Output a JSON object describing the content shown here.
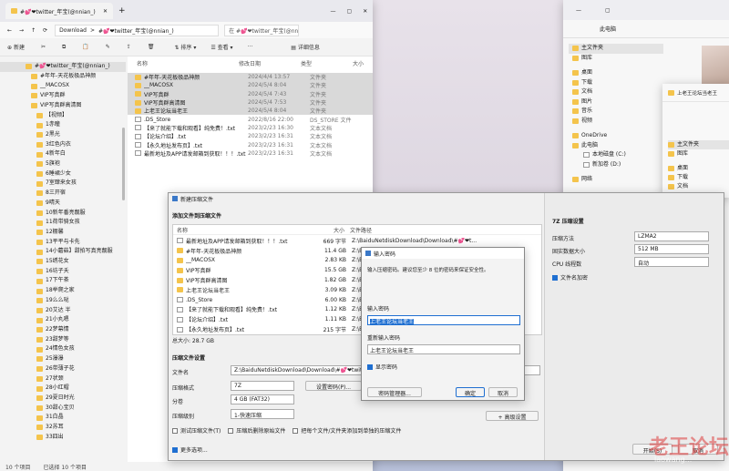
{
  "explorer_main": {
    "tab_title": "#💕❤twitter_年宝(@nnian_)",
    "close_icon": "✕",
    "min_icon": "—",
    "max_icon": "▢",
    "address": [
      "Download",
      ">",
      "#💕❤twitter_年宝(@nnian_)",
      ">"
    ],
    "search_placeholder": "在 #💕❤twitter_年宝(@nnian_)...",
    "toolbar": {
      "new": "新建",
      "sort": "排序",
      "view": "查看",
      "details": "详细信息"
    },
    "columns": {
      "name": "名称",
      "date": "修改日期",
      "type": "类型",
      "size": "大小"
    },
    "files": [
      {
        "name": "#年年-天花板极品神颜",
        "date": "2024/4/4 13:57",
        "type": "文件夹",
        "kind": "folder"
      },
      {
        "name": "__MACOSX",
        "date": "2024/5/4 8:04",
        "type": "文件夹",
        "kind": "folder"
      },
      {
        "name": "VIP写真群",
        "date": "2024/5/4 7:43",
        "type": "文件夹",
        "kind": "folder"
      },
      {
        "name": "VIP写真群高清图",
        "date": "2024/5/4 7:53",
        "type": "文件夹",
        "kind": "folder"
      },
      {
        "name": "上老王论坛当老王",
        "date": "2024/5/4 8:04",
        "type": "文件夹",
        "kind": "folder"
      },
      {
        "name": ".DS_Store",
        "date": "2022/8/16 22:00",
        "type": "DS_STORE 文件",
        "kind": "file"
      },
      {
        "name": "【来了就能下载和观看】纯免费！.txt",
        "date": "2023/2/23 16:30",
        "type": "文本文档",
        "kind": "file"
      },
      {
        "name": "【论坛介绍】.txt",
        "date": "2023/2/23 16:31",
        "type": "文本文档",
        "kind": "file"
      },
      {
        "name": "【永久地址发布页】.txt",
        "date": "2023/2/23 16:31",
        "type": "文本文档",
        "kind": "file"
      },
      {
        "name": "最新地址及APP请发邮箱到获取！！！.txt",
        "date": "2023/2/23 16:31",
        "type": "文本文档",
        "kind": "file"
      }
    ],
    "tree": [
      "#💕❤twitter_年宝(@nnian_)",
      "#年年-天花板极品神颜",
      "__MACOSX",
      "VIP写真群",
      "VIP写真群高清图",
      "【视频】",
      "1赤瞳",
      "2黑光",
      "3红色内衣",
      "4新年白",
      "5旗袍",
      "6睡裙少女",
      "7室肆来女孩",
      "8三开宿",
      "9晴天",
      "10新年番亮靓服",
      "11荷带骑女孩",
      "12棚馨",
      "13平平与卡先",
      "14小蘑菇】甜拍写真亮靓服",
      "15绣花女",
      "16坊子夭",
      "17下午茶",
      "18举爬之家",
      "19么么哒",
      "20艾达 半",
      "21小丸嗯",
      "22梦幕情",
      "23甜梦等",
      "24情色女孩",
      "25瀑瀑",
      "26带薄子花",
      "27状颈",
      "28小红帽",
      "29夏日时光",
      "30甜心宝贝",
      "31白晶",
      "32苏耳",
      "33四出"
    ],
    "status_count": "10 个项目",
    "status_selected": "已选择 10 个项目"
  },
  "explorer_right": {
    "tab": "此电脑",
    "nav": [
      "主文件夹",
      "图库",
      "桌面",
      "下载",
      "文档",
      "图片",
      "音乐",
      "视频",
      "OneDrive",
      "此电脑",
      "本地磁盘 (C:)",
      "新加卷 (D:)",
      "网络"
    ]
  },
  "explorer_small": {
    "title": "上老王论坛当老王",
    "nav": [
      "主文件夹",
      "图库",
      "桌面",
      "下载",
      "文档"
    ]
  },
  "compress_dialog": {
    "title": "新建压缩文件",
    "add_label": "添加文件到压缩文件",
    "col_name": "名称",
    "col_size": "大小",
    "col_path": "文件路径",
    "files": [
      {
        "name": "最新地址及APP请发邮箱到获取！！！.txt",
        "size": "669 字节",
        "path": "Z:\\BaiduNetdiskDownload\\Download\\#💕❤t...",
        "kind": "file"
      },
      {
        "name": "#年年-天花板极品神颜",
        "size": "11.4 GB",
        "path": "Z:\\BaiduNetdiskDownload\\Download\\#💕❤t...",
        "kind": "folder"
      },
      {
        "name": "__MACOSX",
        "size": "2.83 KB",
        "path": "Z:\\BaiduNetdiskDownload\\Download\\#💕❤t...",
        "kind": "folder"
      },
      {
        "name": "VIP写真群",
        "size": "15.5 GB",
        "path": "Z:\\BaiduNetdiskDownload\\Download\\#💕❤t...",
        "kind": "folder"
      },
      {
        "name": "VIP写真群高清图",
        "size": "1.82 GB",
        "path": "Z:\\BaiduNetdiskDownload\\Download\\#💕❤t...",
        "kind": "folder"
      },
      {
        "name": "上老王论坛当老王",
        "size": "3.09 KB",
        "path": "Z:\\BaiduNetdiskDownload\\Download\\#💕❤t...",
        "kind": "folder"
      },
      {
        "name": ".DS_Store",
        "size": "6.00 KB",
        "path": "Z:\\BaiduNetdiskDownload\\Download\\#💕❤t...",
        "kind": "file"
      },
      {
        "name": "【来了就能下载和观看】纯免费！.txt",
        "size": "1.12 KB",
        "path": "Z:\\BaiduNetdiskDownload\\Download\\#💕❤t...",
        "kind": "file"
      },
      {
        "name": "【论坛介绍】.txt",
        "size": "1.11 KB",
        "path": "Z:\\BaiduNetdiskDownload\\Download\\#💕❤t...",
        "kind": "file"
      },
      {
        "name": "【永久地址发布页】.txt",
        "size": "215 字节",
        "path": "Z:\\BaiduNetdiskDownload\\Download\\#💕❤t...",
        "kind": "file"
      }
    ],
    "total": "总大小: 28.7 GB",
    "settings_label": "压缩文件设置",
    "filename_label": "文件名",
    "filename_value": "Z:\\BaiduNetdiskDownload\\Download\\#💕❤twitter_",
    "format_label": "压缩格式",
    "format_value": "7Z",
    "volume_label": "分卷",
    "volume_value": "4 GB (FAT32)",
    "level_label": "压缩级别",
    "level_value": "1-快速压缩",
    "set_password": "设置密码(P)...",
    "advanced": "+ 高级设置",
    "cb_test": "测试压缩文件(T)",
    "cb_delete": "压缩后删除原始文件",
    "cb_separate": "把每个文件/文件夹添加到单独的压缩文件",
    "cb_more": "更多选项...",
    "right_title": "7Z 压缩设置",
    "method_label": "压缩方法",
    "method_value": "LZMA2",
    "dict_label": "固实数据大小",
    "dict_value": "512 MB",
    "cpu_label": "CPU 线程数",
    "cpu_value": "自动",
    "encrypt_names": "文件名加密",
    "start": "开始(S)",
    "cancel": "取消"
  },
  "password_dialog": {
    "title": "输入密码",
    "desc": "输入压缩密码。建议您至少 8 位的密码来保证安全性。",
    "pwd_label": "输入密码",
    "pwd_value": "上老王论坛当老王",
    "repeat_label": "重新输入密码",
    "repeat_value": "上老王论坛当老王",
    "show_pwd": "显示密码",
    "manager": "密码管理器...",
    "ok": "确定",
    "cancel": "取消"
  },
  "watermark": "老王论坛",
  "watermark_url": "laowang..."
}
